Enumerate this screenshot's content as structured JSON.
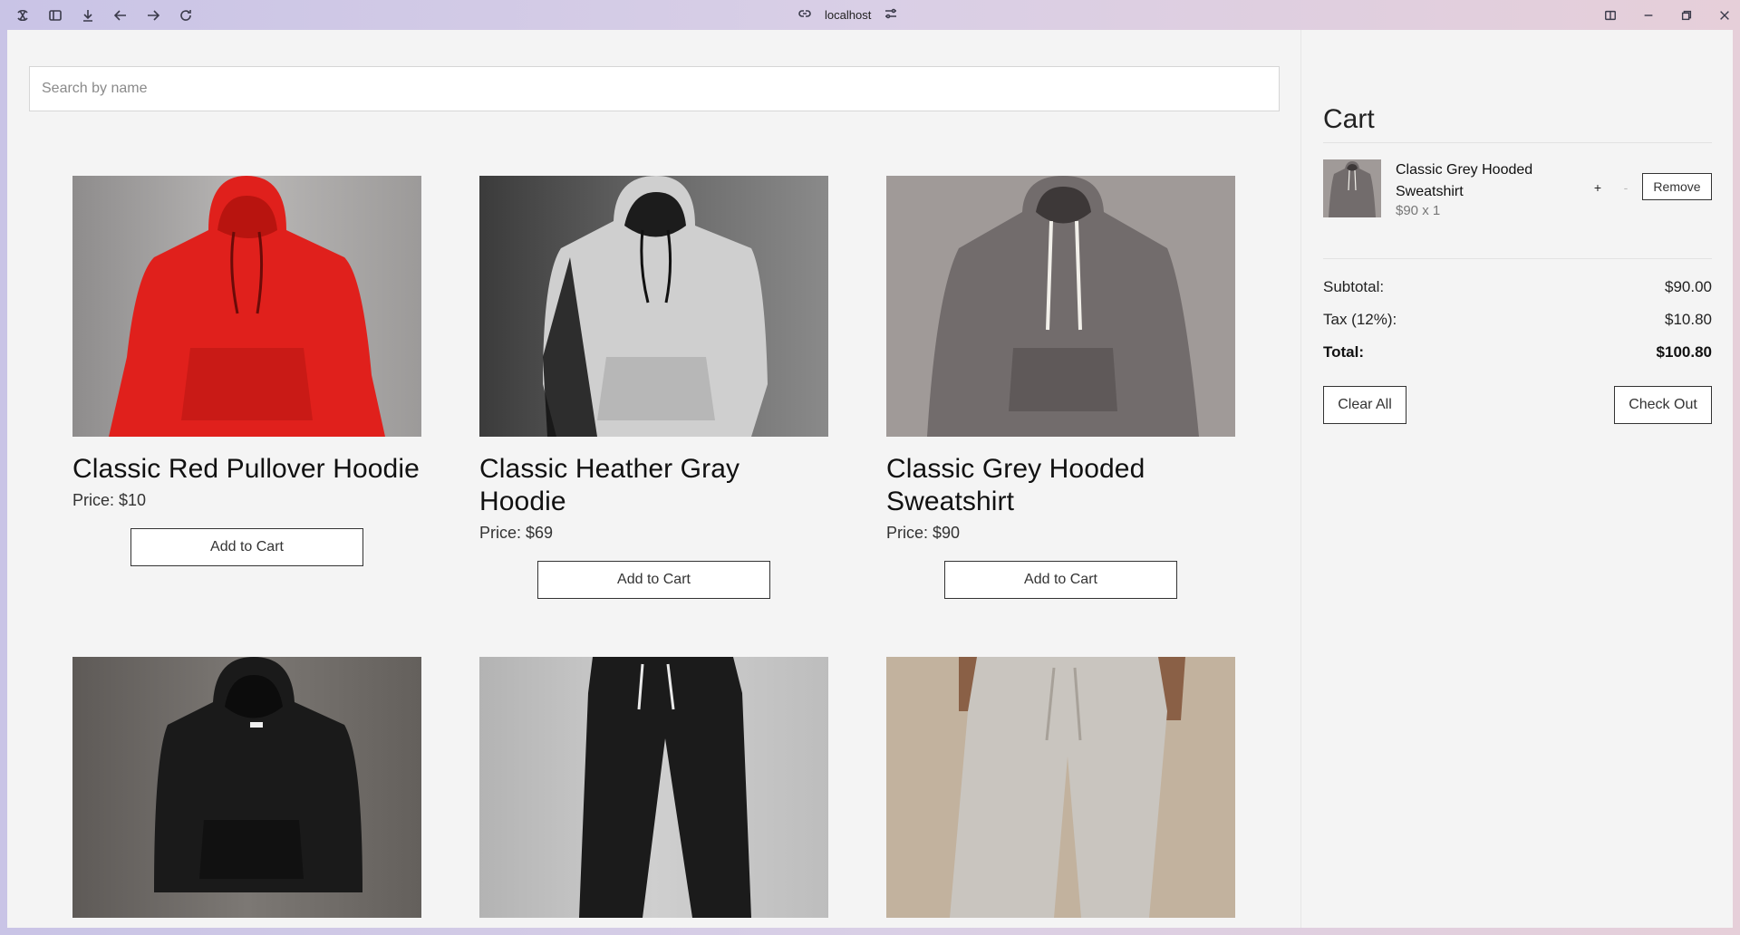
{
  "browser": {
    "url": "localhost"
  },
  "search": {
    "placeholder": "Search by name",
    "value": ""
  },
  "products": [
    {
      "title": "Classic Red Pullover Hoodie",
      "price": "Price: $10",
      "button": "Add to Cart",
      "image": "red-hoodie"
    },
    {
      "title": "Classic Heather Gray Hoodie",
      "price": "Price: $69",
      "button": "Add to Cart",
      "image": "heather-gray-hoodie"
    },
    {
      "title": "Classic Grey Hooded Sweatshirt",
      "price": "Price: $90",
      "button": "Add to Cart",
      "image": "grey-hooded-sweatshirt"
    },
    {
      "title": "",
      "price": "",
      "button": "",
      "image": "black-hoodie"
    },
    {
      "title": "",
      "price": "",
      "button": "",
      "image": "black-joggers"
    },
    {
      "title": "",
      "price": "",
      "button": "",
      "image": "grey-sweatpants"
    }
  ],
  "cart": {
    "title": "Cart",
    "items": [
      {
        "name": "Classic Grey Hooded Sweatshirt",
        "qty_text": "$90 x 1",
        "plus": "+",
        "minus": "-",
        "remove": "Remove"
      }
    ],
    "subtotal_label": "Subtotal:",
    "subtotal_value": "$90.00",
    "tax_label": "Tax (12%):",
    "tax_value": "$10.80",
    "total_label": "Total:",
    "total_value": "$100.80",
    "clear_label": "Clear All",
    "checkout_label": "Check Out"
  },
  "colors": {
    "page_bg": "#f4f4f4",
    "red_hoodie": "#e0201c",
    "heather_gray": "#c9c9c9",
    "grey_sweatshirt": "#6f6b6b",
    "black": "#1a1a1a"
  }
}
